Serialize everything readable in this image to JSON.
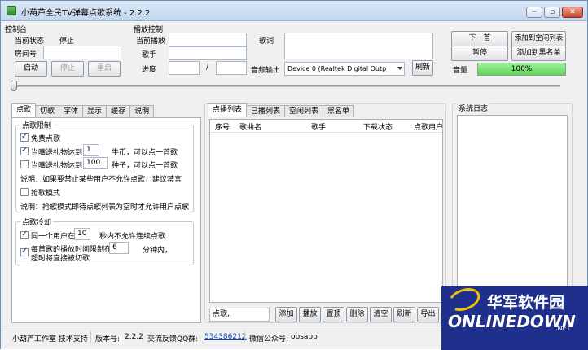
{
  "window": {
    "title": "小葫芦全民TV弹幕点歌系统 - 2.2.2",
    "controls": {
      "minimize": "─",
      "restore": "▫",
      "close": "✕"
    }
  },
  "control_panel": {
    "section_title": "控制台",
    "status_label": "当前状态",
    "status_value": "停止",
    "room_label": "房间号",
    "room_value": "",
    "start_button": "启动",
    "stop_button": "停止",
    "restart_button": "重启"
  },
  "playback": {
    "section_title": "播放控制",
    "now_playing_label": "当前播放",
    "now_playing_value": "",
    "singer_label": "歌手",
    "singer_value": "",
    "progress_label": "进度",
    "progress_current": "",
    "progress_sep": "/",
    "progress_total": "",
    "lyrics_label": "歌词",
    "lyrics_value": "",
    "audio_output_label": "音频输出",
    "audio_output_value": "Device 0 (Realtek Digital Outp",
    "refresh_button": "刷新",
    "next_button": "下一首",
    "pause_button": "暂停",
    "add_idle_button": "添加到空闲列表",
    "add_blacklist_button": "添加到黑名单",
    "volume_label": "音量",
    "volume_value": "100%",
    "volume_fraction": 1.0,
    "seek_fraction": 0.0
  },
  "left_tabs": [
    "点歌",
    "切歌",
    "字体",
    "显示",
    "缓存",
    "说明"
  ],
  "song_request": {
    "limit_group_title": "点歌限制",
    "free_label": "免费点歌",
    "free_checked": true,
    "gift1_prefix": "当嘴送礼物达到",
    "gift1_value": "1",
    "gift1_suffix": "牛币，可以点一首歌",
    "gift1_checked": true,
    "gift2_prefix": "当嘴送礼物达到",
    "gift2_value": "100",
    "gift2_suffix": "种子，可以点一首歌",
    "gift2_checked": false,
    "note1": "说明：如果要禁止某些用户不允许点歌，建议禁言",
    "grab_label": "抢歌模式",
    "grab_checked": false,
    "note2": "说明：抢歌模式即待点歌列表为空时才允许用户点歌",
    "cooldown_group_title": "点歌冷却",
    "cd1_prefix": "同一个用户在",
    "cd1_value": "10",
    "cd1_suffix": "秒内不允许连续点歌",
    "cd1_checked": true,
    "cd2_line1": "每首歌的播放时间限制在",
    "cd2_line2": "超时将直接被切歌",
    "cd2_value": "6",
    "cd2_suffix": "分钟内，",
    "cd2_checked": true
  },
  "list_tabs": [
    "点播列表",
    "已播列表",
    "空闲列表",
    "黑名单"
  ],
  "song_table": {
    "columns": [
      "序号",
      "歌曲名",
      "歌手",
      "下载状态",
      "点歌用户"
    ],
    "rows": []
  },
  "list_actions": {
    "input_value": "点歌,",
    "buttons": [
      "添加",
      "播放",
      "置顶",
      "删除",
      "清空",
      "刷新",
      "导出"
    ]
  },
  "system_log": {
    "title": "系统日志"
  },
  "statusbar": {
    "studio": "小葫芦工作室 技术支持",
    "version_label": "版本号:",
    "version_value": "2.2.2",
    "qq_label": "交流反馈QQ群:",
    "qq_value": "534386212",
    "wechat_label": "微信公众号:",
    "wechat_value": "obsapp"
  },
  "watermark": {
    "cn": "华军软件园",
    "en": "ONLINEDOWN",
    "suffix": ".NET"
  }
}
